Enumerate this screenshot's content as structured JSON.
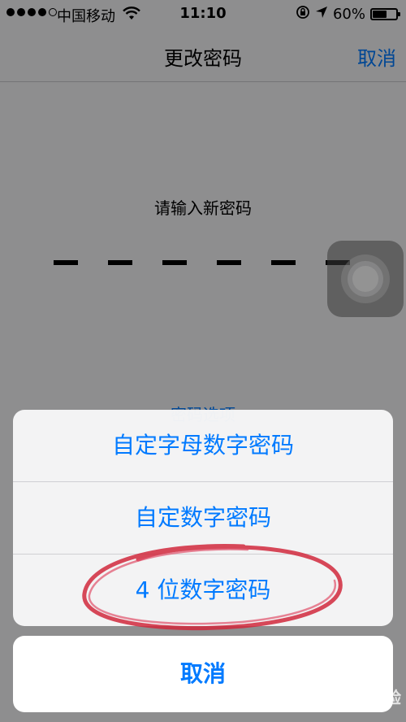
{
  "status_bar": {
    "carrier": "中国移动",
    "time": "11:10",
    "battery_percent": "60%",
    "battery_level": 0.6,
    "signal_bars": 4
  },
  "nav": {
    "title": "更改密码",
    "cancel_label": "取消"
  },
  "content": {
    "prompt": "请输入新密码",
    "passcode_slots": 6,
    "options_link": "密码选项"
  },
  "action_sheet": {
    "options": [
      {
        "label": "自定字母数字密码"
      },
      {
        "label": "自定数字密码"
      },
      {
        "label": "4 位数字密码"
      }
    ],
    "cancel_label": "取消"
  },
  "watermark": "Bai 经验",
  "colors": {
    "accent": "#007aff",
    "annotation": "#d0283c"
  },
  "icons": [
    "wifi-icon",
    "lock-rotation-icon",
    "location-arrow-icon",
    "battery-icon",
    "assistive-touch-icon"
  ]
}
